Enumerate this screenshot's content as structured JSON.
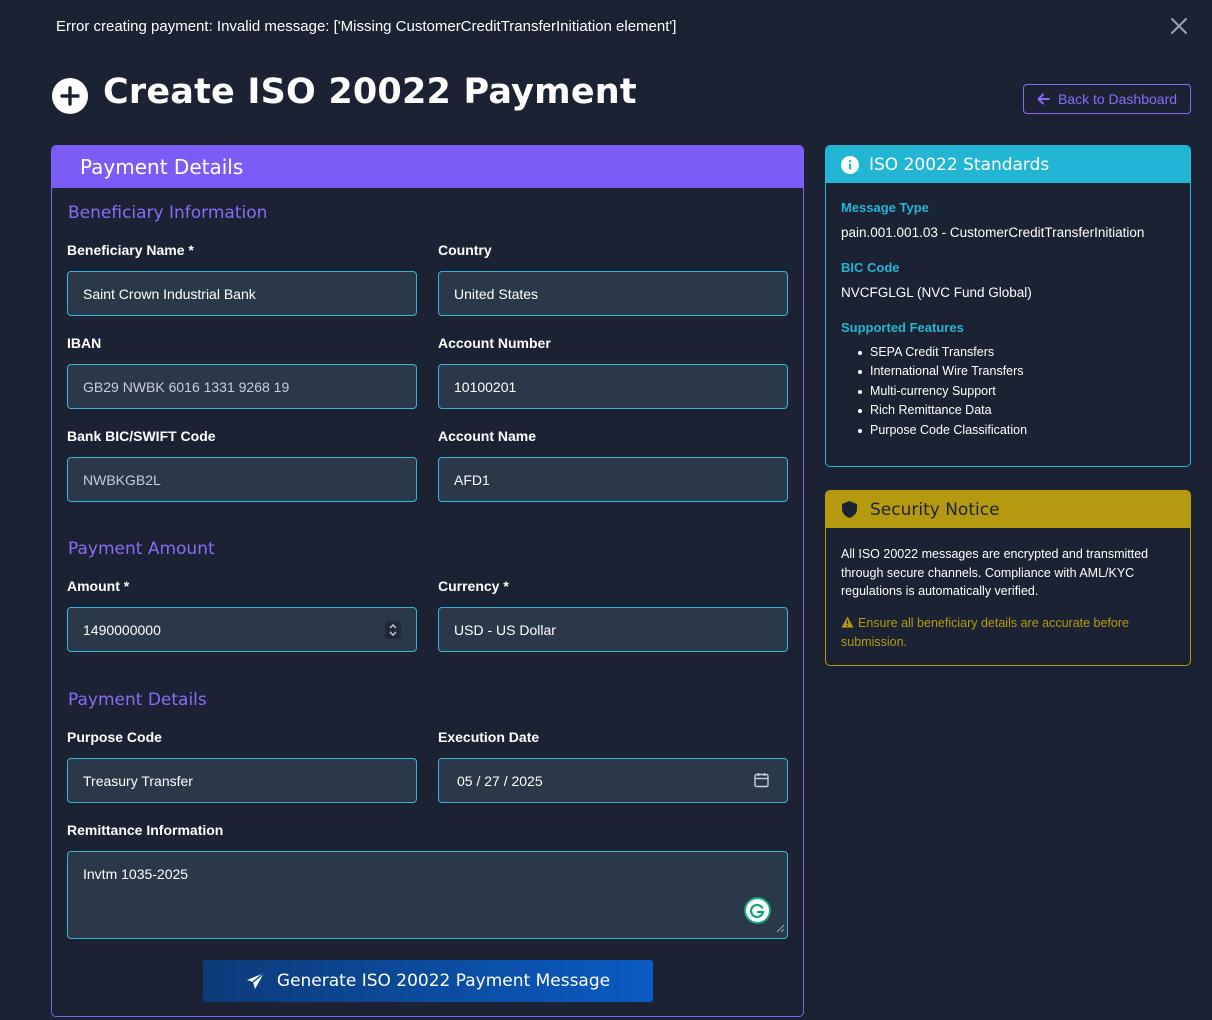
{
  "alert": {
    "message": "Error creating payment: Invalid message: ['Missing CustomerCreditTransferInitiation element']"
  },
  "header": {
    "title": "Create ISO 20022 Payment",
    "back_label": "Back to Dashboard"
  },
  "form": {
    "card_title": "Payment Details",
    "sections": {
      "beneficiary": "Beneficiary Information",
      "amount": "Payment Amount",
      "details": "Payment Details"
    },
    "fields": {
      "beneficiary_name": {
        "label": "Beneficiary Name *",
        "value": "Saint Crown Industrial Bank"
      },
      "country": {
        "label": "Country",
        "value": "United States"
      },
      "iban": {
        "label": "IBAN",
        "value": "GB29 NWBK 6016 1331 9268 19"
      },
      "account_number": {
        "label": "Account Number",
        "value": "10100201"
      },
      "bic": {
        "label": "Bank BIC/SWIFT Code",
        "value": "NWBKGB2L"
      },
      "account_name": {
        "label": "Account Name",
        "value": "AFD1"
      },
      "amount": {
        "label": "Amount *",
        "value": "1490000000"
      },
      "currency": {
        "label": "Currency *",
        "value": "USD - US Dollar"
      },
      "purpose_code": {
        "label": "Purpose Code",
        "value": "Treasury Transfer"
      },
      "execution_date": {
        "label": "Execution Date",
        "value": "05 / 27 / 2025"
      },
      "remittance": {
        "label": "Remittance Information",
        "value": "Invtm 1035-2025"
      }
    },
    "submit_label": "Generate ISO 20022 Payment Message"
  },
  "standards": {
    "title": "ISO 20022 Standards",
    "message_type_label": "Message Type",
    "message_type_value": "pain.001.001.03 - CustomerCreditTransferInitiation",
    "bic_label": "BIC Code",
    "bic_value": "NVCFGLGL (NVC Fund Global)",
    "features_label": "Supported Features",
    "features": [
      "SEPA Credit Transfers",
      "International Wire Transfers",
      "Multi-currency Support",
      "Rich Remittance Data",
      "Purpose Code Classification"
    ]
  },
  "security": {
    "title": "Security Notice",
    "body": "All ISO 20022 messages are encrypted and transmitted through secure channels. Compliance with AML/KYC regulations is automatically verified.",
    "warning": "Ensure all beneficiary details are accurate before submission."
  },
  "colors": {
    "background": "#1b2233",
    "primary": "#7b5cf7",
    "info": "#22b6d4",
    "warning": "#b59a10",
    "input_bg": "#2a3849"
  }
}
